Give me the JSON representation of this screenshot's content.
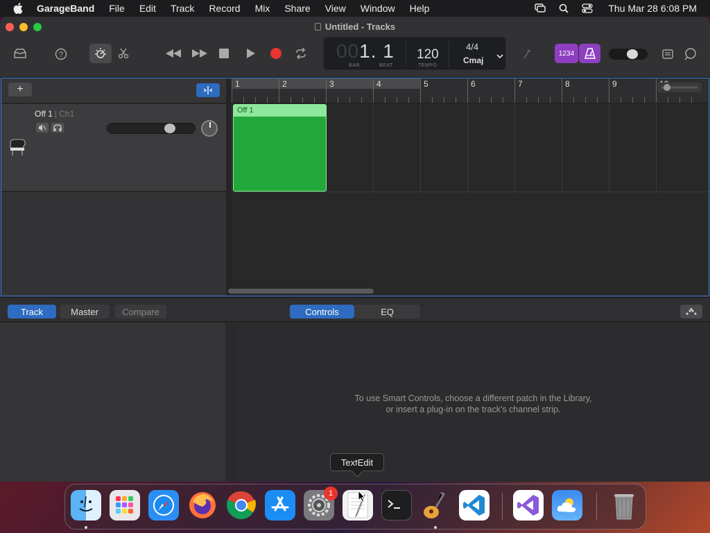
{
  "menubar": {
    "items": [
      "GarageBand",
      "File",
      "Edit",
      "Track",
      "Record",
      "Mix",
      "Share",
      "View",
      "Window",
      "Help"
    ],
    "clock": "Thu Mar 28  6:08 PM"
  },
  "window": {
    "title": "Untitled - Tracks"
  },
  "lcd": {
    "position_dim": "00",
    "position": "1. 1",
    "bar_label": "BAR",
    "beat_label": "BEAT",
    "tempo": "120",
    "tempo_label": "TEMPO",
    "time_signature": "4/4",
    "key": "Cmaj"
  },
  "count_in_label": "1234",
  "tracks_header": {
    "add_label": "+"
  },
  "track": {
    "name": "Off 1",
    "channel": "| Ch1",
    "volume_level": 0.72
  },
  "ruler": {
    "bars": [
      "1",
      "2",
      "3",
      "4",
      "5",
      "6",
      "7",
      "8",
      "9",
      "10"
    ]
  },
  "region": {
    "title": "Off 1",
    "color": "#22a83a"
  },
  "smart_controls": {
    "tabs_left": [
      "Track",
      "Master",
      "Compare"
    ],
    "tabs_center": [
      "Controls",
      "EQ"
    ],
    "message_line1": "To use Smart Controls, choose a different patch in the Library,",
    "message_line2": "or insert a plug-in on the track's channel strip."
  },
  "dock": {
    "tooltip": "TextEdit",
    "settings_badge": "1",
    "apps": [
      "Finder",
      "Launchpad",
      "Safari",
      "Firefox",
      "Chrome",
      "App Store",
      "System Settings",
      "TextEdit",
      "Terminal",
      "GarageBand",
      "Visual Studio Code",
      "Visual Studio",
      "Weather",
      "Trash"
    ]
  },
  "colors": {
    "accent": "#2d6cc0",
    "record": "#e8352e",
    "purple": "#8e3fc0"
  }
}
